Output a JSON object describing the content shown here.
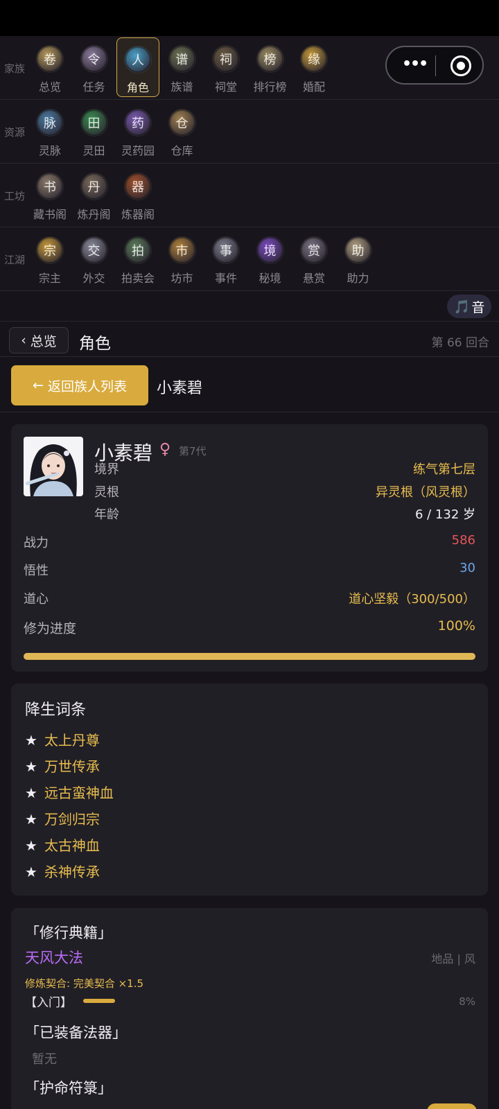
{
  "nav": {
    "rows": [
      {
        "label": "家族",
        "items": [
          {
            "label": "总览",
            "icon": "scroll-icon",
            "color": "#b79a5a",
            "glyph": "卷"
          },
          {
            "label": "任务",
            "icon": "mission-icon",
            "color": "#8a7a9a",
            "glyph": "令"
          },
          {
            "label": "角色",
            "icon": "character-icon",
            "color": "#4aa0c8",
            "glyph": "人",
            "active": true
          },
          {
            "label": "族谱",
            "icon": "tree-icon",
            "color": "#6a7050",
            "glyph": "谱"
          },
          {
            "label": "祠堂",
            "icon": "shrine-icon",
            "color": "#6a5a40",
            "glyph": "祠"
          },
          {
            "label": "排行榜",
            "icon": "ranking-icon",
            "color": "#9a8a60",
            "glyph": "榜"
          },
          {
            "label": "婚配",
            "icon": "marriage-icon",
            "color": "#c79a3a",
            "glyph": "缘"
          }
        ]
      },
      {
        "label": "资源",
        "items": [
          {
            "label": "灵脉",
            "icon": "spirit-vein-icon",
            "color": "#4a7aa0",
            "glyph": "脉"
          },
          {
            "label": "灵田",
            "icon": "spirit-field-icon",
            "color": "#3a8a50",
            "glyph": "田"
          },
          {
            "label": "灵药园",
            "icon": "herb-garden-icon",
            "color": "#7a5ab0",
            "glyph": "药"
          },
          {
            "label": "仓库",
            "icon": "warehouse-icon",
            "color": "#a08050",
            "glyph": "仓"
          }
        ]
      },
      {
        "label": "工坊",
        "items": [
          {
            "label": "藏书阁",
            "icon": "library-icon",
            "color": "#8a7a6a",
            "glyph": "书"
          },
          {
            "label": "炼丹阁",
            "icon": "alchemy-icon",
            "color": "#7a6a5a",
            "glyph": "丹"
          },
          {
            "label": "炼器阁",
            "icon": "forge-icon",
            "color": "#a0502a",
            "glyph": "器"
          }
        ]
      },
      {
        "label": "江湖",
        "items": [
          {
            "label": "宗主",
            "icon": "sect-leader-icon",
            "color": "#c79a3a",
            "glyph": "宗"
          },
          {
            "label": "外交",
            "icon": "diplomacy-icon",
            "color": "#8a8a9a",
            "glyph": "交"
          },
          {
            "label": "拍卖会",
            "icon": "auction-icon",
            "color": "#5a7a5a",
            "glyph": "拍"
          },
          {
            "label": "坊市",
            "icon": "market-icon",
            "color": "#b0803a",
            "glyph": "市"
          },
          {
            "label": "事件",
            "icon": "event-icon",
            "color": "#7a7a8a",
            "glyph": "事"
          },
          {
            "label": "秘境",
            "icon": "secret-realm-icon",
            "color": "#7a4ac0",
            "glyph": "境"
          },
          {
            "label": "悬赏",
            "icon": "bounty-icon",
            "color": "#7a7080",
            "glyph": "赏"
          },
          {
            "label": "助力",
            "icon": "assist-icon",
            "color": "#b0a080",
            "glyph": "助"
          }
        ]
      }
    ]
  },
  "capsule": {
    "more_icon": "more-dots-icon",
    "close_icon": "target-circle-icon"
  },
  "music": {
    "note": "🎵",
    "label": "音"
  },
  "breadcrumb": {
    "back_arrow": "‹",
    "back_label": "总览",
    "title": "角色",
    "round": "第 66 回合"
  },
  "sub_header": {
    "return_arrow": "←",
    "return_label": "返回族人列表",
    "character_name": "小素碧"
  },
  "character": {
    "name": "小素碧",
    "gender_symbol": "♀",
    "generation": "第7代",
    "realm_label": "境界",
    "realm_value": "练气第七层",
    "root_label": "灵根",
    "root_value": "异灵根（风灵根）",
    "age_label": "年龄",
    "age_value": "6 / 132 岁",
    "power_label": "战力",
    "power_value": "586",
    "insight_label": "悟性",
    "insight_value": "30",
    "dao_label": "道心",
    "dao_value": "道心坚毅（300/500）",
    "progress_label": "修为进度",
    "progress_value": "100%",
    "progress_fraction": 1.0
  },
  "birth_traits": {
    "title": "降生词条",
    "star": "★",
    "items": [
      "太上丹尊",
      "万世传承",
      "远古蛮神血",
      "万剑归宗",
      "太古神血",
      "杀神传承"
    ]
  },
  "cultivation": {
    "manual_title": "「修行典籍」",
    "manual_name": "天风大法",
    "manual_grade": "地品 | 风",
    "manual_fit": "修炼契合: 完美契合 ×1.5",
    "manual_level": "【入门】",
    "manual_progress": "8%",
    "manual_progress_fraction": 0.08,
    "artifact_title": "「已装备法器」",
    "artifact_value": "暂无",
    "talisman_title": "「护命符箓」"
  }
}
